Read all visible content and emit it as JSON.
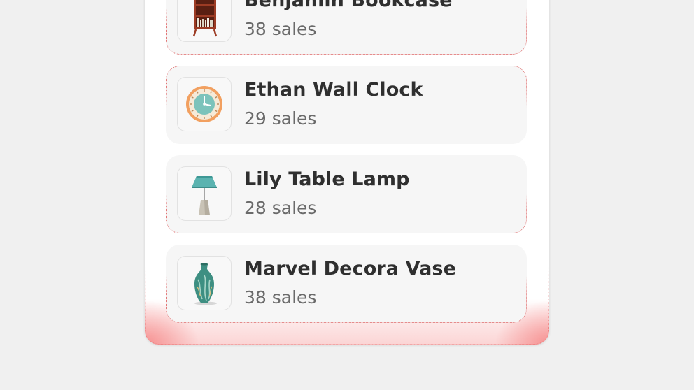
{
  "products": [
    {
      "name": "Benjamin Bookcase",
      "sales": "38 sales",
      "icon": "bookcase-icon"
    },
    {
      "name": "Ethan Wall Clock",
      "sales": "29 sales",
      "icon": "wall-clock-icon"
    },
    {
      "name": "Lily Table Lamp",
      "sales": "28 sales",
      "icon": "table-lamp-icon"
    },
    {
      "name": "Marvel Decora Vase",
      "sales": "38 sales",
      "icon": "vase-icon"
    }
  ],
  "colors": {
    "highlight": "#e06464",
    "card_background": "#f6f6f6",
    "page_background": "#f0f0f0"
  }
}
